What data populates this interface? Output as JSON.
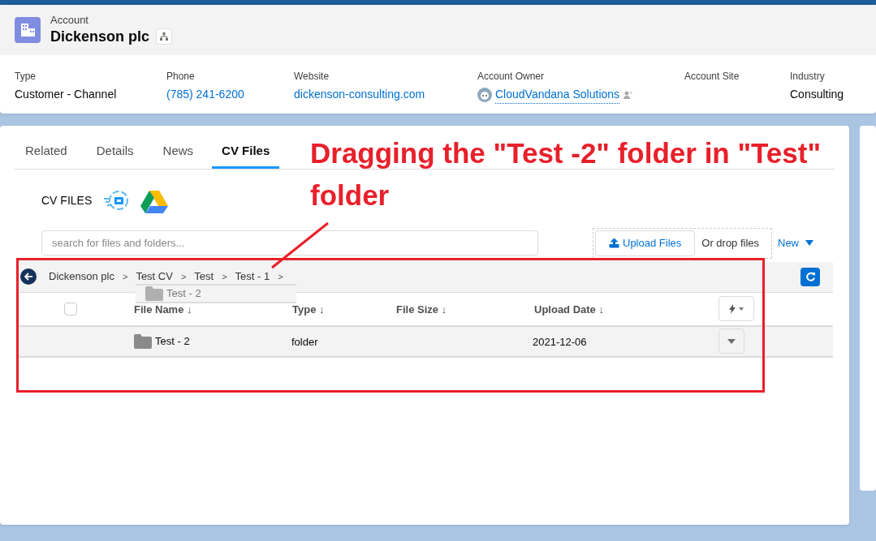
{
  "header": {
    "object_label": "Account",
    "title": "Dickenson plc"
  },
  "fields": [
    {
      "label": "Type",
      "value": "Customer - Channel",
      "kind": "text"
    },
    {
      "label": "Phone",
      "value": "(785) 241-6200",
      "kind": "link"
    },
    {
      "label": "Website",
      "value": "dickenson-consulting.com",
      "kind": "link"
    },
    {
      "label": "Account Owner",
      "value": "CloudVandana Solutions",
      "kind": "owner"
    },
    {
      "label": "Account Site",
      "kind": "empty"
    },
    {
      "label": "Industry",
      "value": "Consulting",
      "kind": "text"
    }
  ],
  "tabs": [
    {
      "label": "Related",
      "selected": false
    },
    {
      "label": "Details",
      "selected": false
    },
    {
      "label": "News",
      "selected": false
    },
    {
      "label": "CV Files",
      "selected": true
    }
  ],
  "section_title": "CV FILES",
  "search": {
    "placeholder": "search for files and folders..."
  },
  "upload": {
    "button": "Upload Files",
    "drop_hint": "Or drop files"
  },
  "new_button": "New",
  "breadcrumb": [
    {
      "label": "Dickenson plc",
      "separator": ">"
    },
    {
      "label": "Test CV",
      "separator": ">"
    },
    {
      "label": "Test",
      "separator": ">"
    },
    {
      "label": "Test - 1",
      "separator": ">"
    }
  ],
  "drag_ghost": {
    "label": "Test - 2"
  },
  "table": {
    "select_all": {
      "checked": false
    },
    "columns": [
      "File Name ↓",
      "Type ↓",
      "File Size ↓",
      "Upload Date ↓"
    ],
    "rows": [
      {
        "name": "Test - 2",
        "type": "folder",
        "upload_date": "2021-12-06"
      }
    ]
  },
  "annotation": {
    "text": "Dragging the \"Test -2\" folder in \"Test\" folder"
  }
}
